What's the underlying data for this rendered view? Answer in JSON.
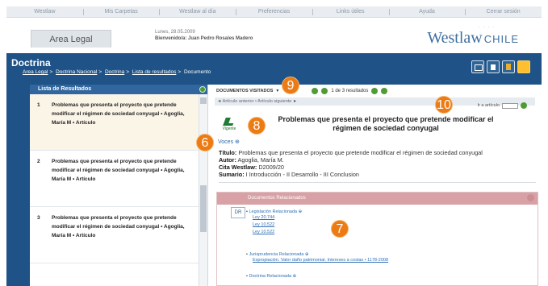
{
  "topnav": [
    "Westlaw",
    "Mis Carpetas",
    "Westlaw al día",
    "Preferencias",
    "Links útiles",
    "Ayuda",
    "Cerrar sesión"
  ],
  "header": {
    "area_tab": "Area Legal",
    "session_line1": "Lunes, 28.05.2009",
    "session_line2": "Bienvenido/a: Juan Pedro Rosales Madero",
    "logo_westlaw": "Westlaw",
    "logo_chile": "CHILE"
  },
  "main": {
    "title": "Doctrina",
    "breadcrumb": [
      "Area Legal",
      "Doctrina Nacional",
      "Doctrina",
      "Lista de resultados"
    ],
    "breadcrumb_current": "Documento"
  },
  "left": {
    "header": "Lista de Resultados",
    "items": [
      {
        "num": "1",
        "text": "Problemas que presenta el proyecto que pretende modificar el régimen de sociedad conyugal • Agoglia, María M • Artículo"
      },
      {
        "num": "2",
        "text": "Problemas que presenta el proyecto que pretende modificar el régimen de sociedad conyugal • Agoglia, María M • Artículo"
      },
      {
        "num": "3",
        "text": "Problemas que presenta el proyecto que pretende modificar el régimen de sociedad conyugal • Agoglia, María M • Artículo"
      }
    ]
  },
  "content": {
    "visited": "Documentos visitados",
    "pager": "1 de 3 resultados",
    "subnav": "◄ Artículo anterior  •  Artículo siguiente ►",
    "goto_label": "Ir a artículo",
    "vigente": "Vigente",
    "doc_title": "Problemas que presenta el proyecto que pretende modificar el régimen de sociedad conyugal",
    "voces": "Voces ⊕",
    "details": {
      "titulo_label": "Título:",
      "titulo": "Problemas que presenta el proyecto que pretende modificar el régimen de sociedad conyugal",
      "autor_label": "Autor:",
      "autor": "Agoglia, María M.",
      "cita_label": "Cita Westlaw:",
      "cita": "D2009/20",
      "sumario_label": "Sumario:",
      "sumario": "I Introducción - II Desarrollo - III Conclusion"
    },
    "related": {
      "header": "Documentos Relacionados",
      "badge": "DR",
      "legislacion": "Legislación Relacionada ⊕",
      "leyes": [
        "Ley 20.744",
        "Ley 10.522",
        "Ley 10.522"
      ],
      "jurisprudencia": "Jurisprudencia Relacionada ⊕",
      "jurisprudencia_link": "Expropiación. Valor daño patrimonial. Intereses a costas • 1178-2008",
      "doctrina": "Doctrina Relacionada ⊕"
    }
  },
  "badges": [
    "6",
    "7",
    "8",
    "9",
    "10"
  ],
  "colors": {
    "accent_blue": "#1f5286",
    "badge_orange": "#ec7b14",
    "related_pink": "#d8a1a5"
  }
}
